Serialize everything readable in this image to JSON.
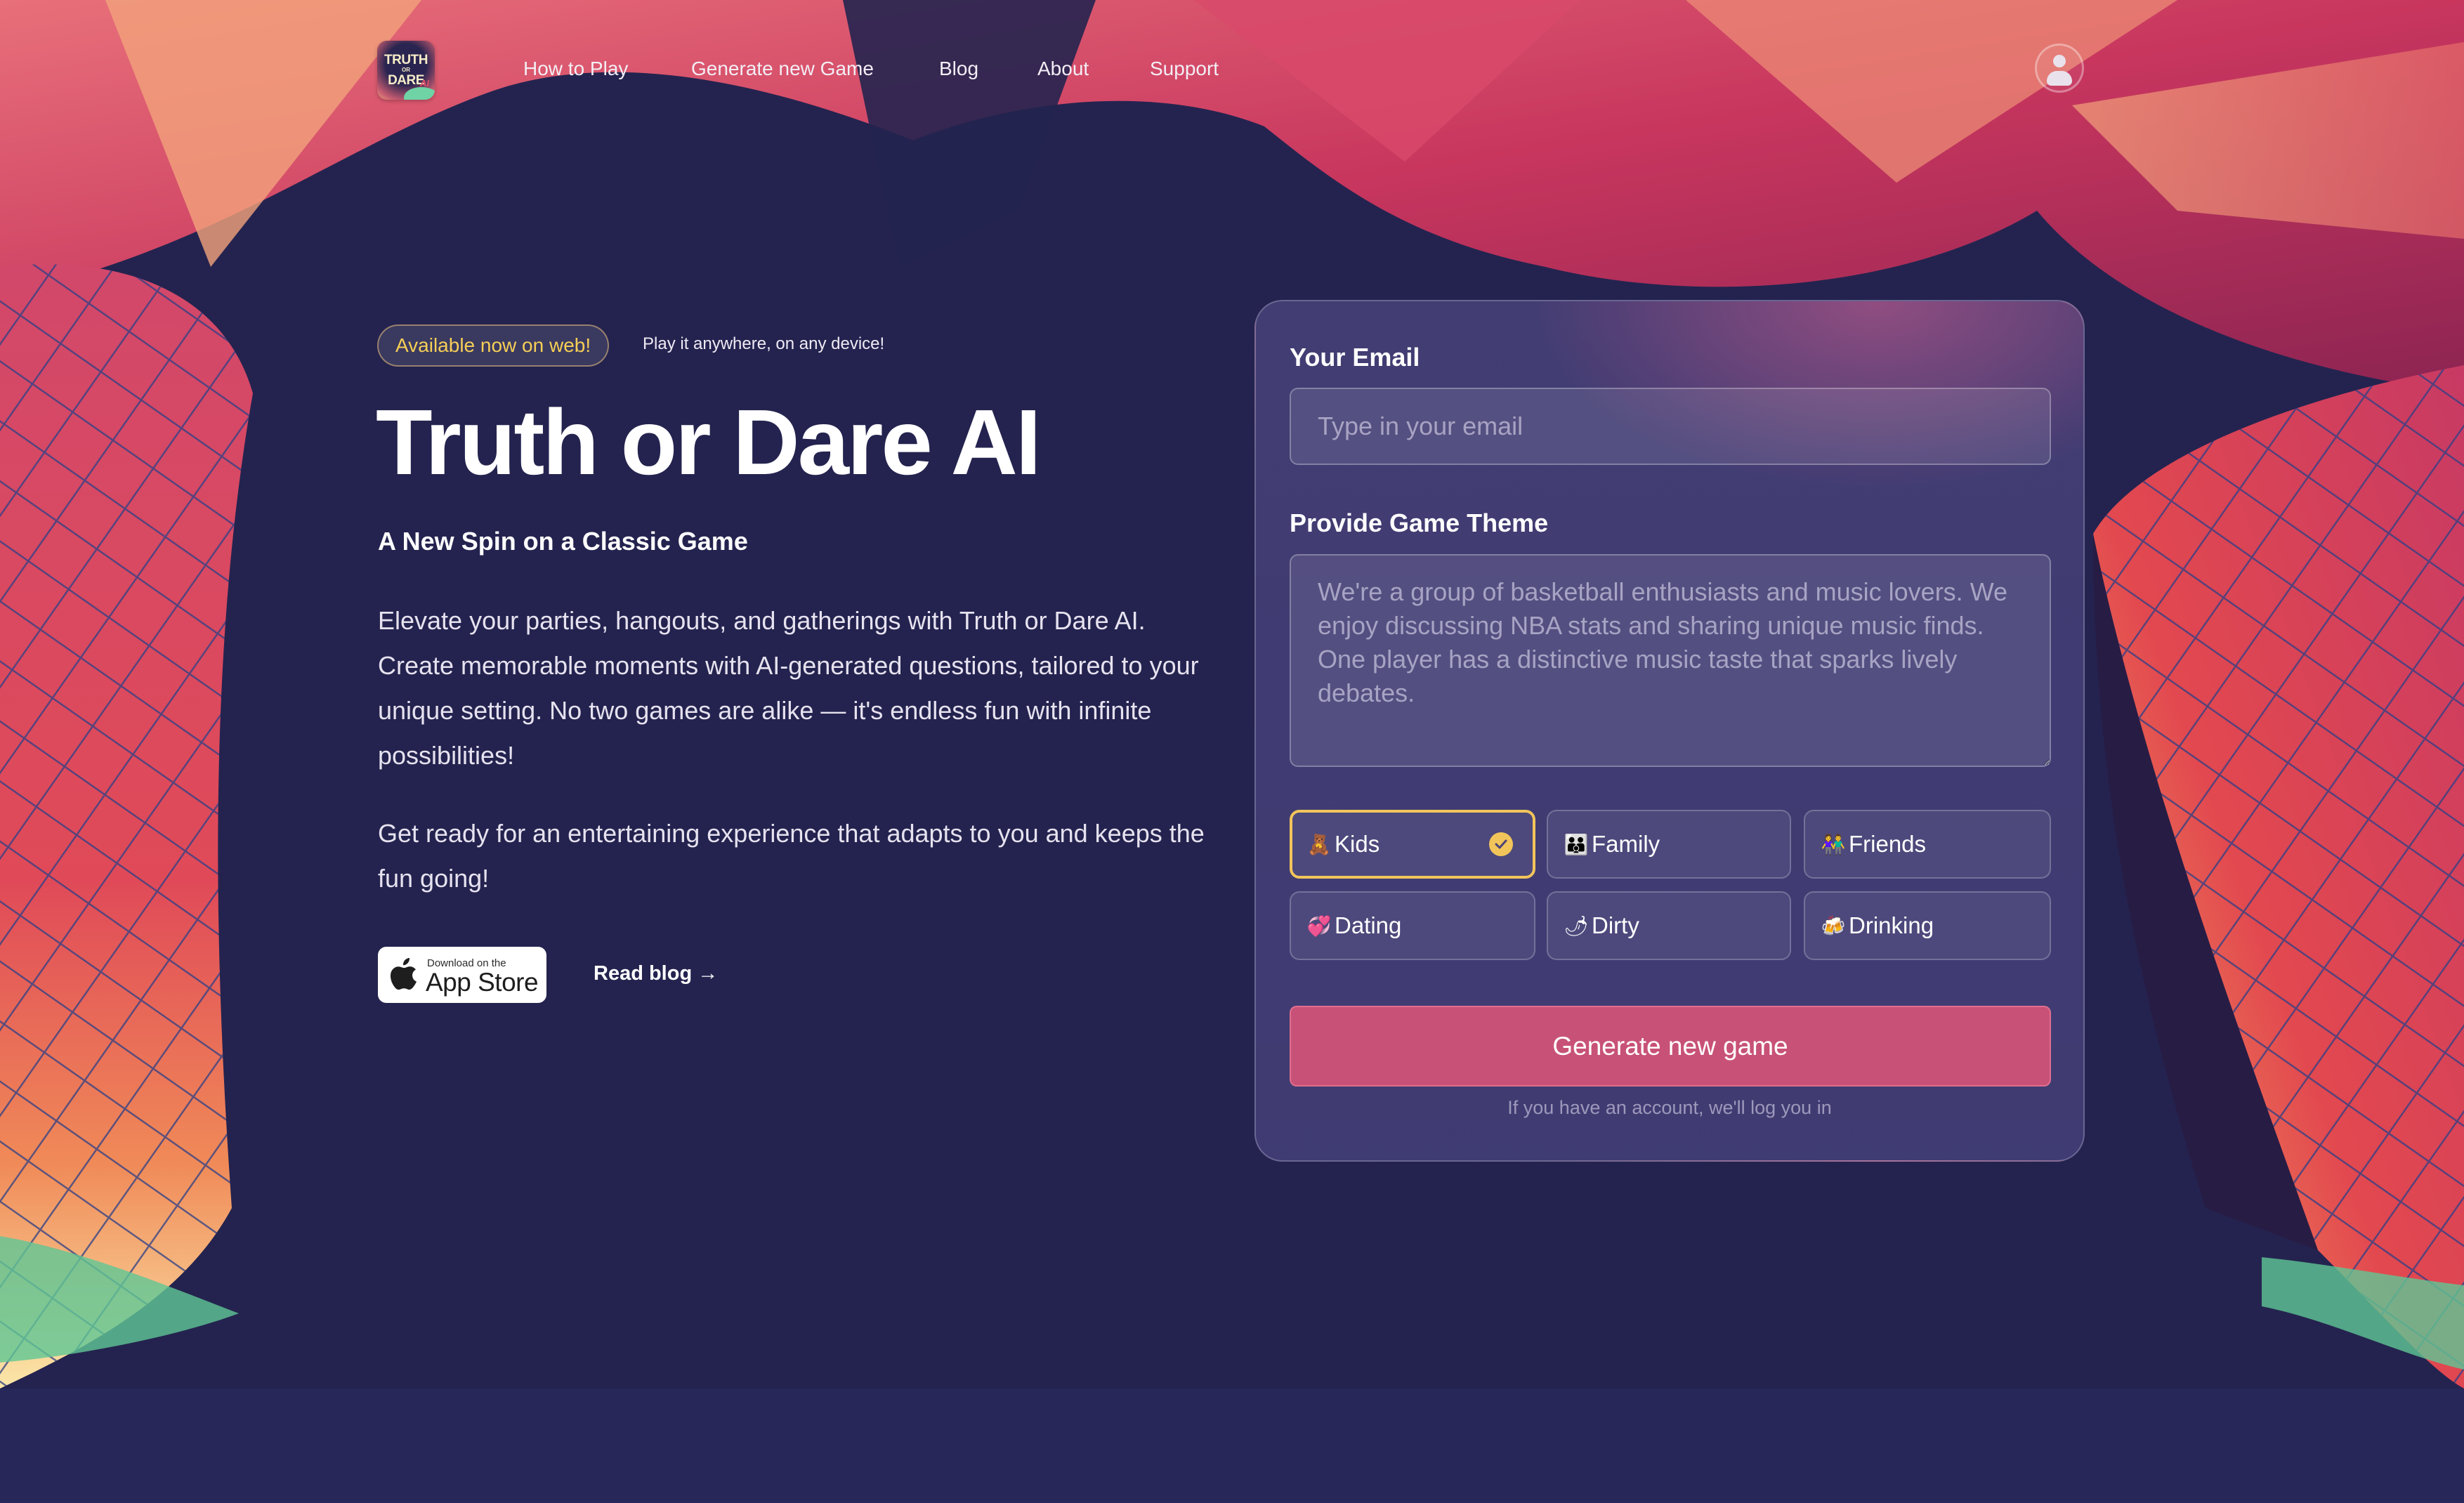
{
  "nav": {
    "logo": {
      "line1": "TRUTH",
      "line2": "OR",
      "line3": "DARE",
      "ai": "AI"
    },
    "links": [
      {
        "label": "How to Play"
      },
      {
        "label": "Generate new Game"
      },
      {
        "label": "Blog"
      },
      {
        "label": "About"
      },
      {
        "label": "Support"
      }
    ],
    "account_icon": "user-circle-icon"
  },
  "hero": {
    "badge": "Available now on web!",
    "badge_note": "Play it anywhere, on any device!",
    "title": "Truth or Dare AI",
    "subtitle": "A New Spin on a Classic Game",
    "paragraph1": "Elevate your parties, hangouts, and gatherings with Truth or Dare AI. Create memorable moments with AI-generated questions, tailored to your unique setting. No two games are alike — it's endless fun with infinite possibilities!",
    "paragraph2": "Get ready for an entertaining experience that adapts to you and keeps the fun going!",
    "appstore": {
      "small": "Download on the",
      "big": "App Store",
      "icon": "apple-icon"
    },
    "read_blog": "Read blog →"
  },
  "form": {
    "email_label": "Your Email",
    "email_placeholder": "Type in your email",
    "email_value": "",
    "theme_label": "Provide Game Theme",
    "theme_placeholder": "We're a group of basketball enthusiasts and music lovers. We enjoy discussing NBA stats and sharing unique music finds. One player has a distinctive music taste that sparks lively debates.",
    "theme_value": "",
    "categories": [
      {
        "label": "Kids",
        "emoji": "🧸",
        "icon": "teddy-bear-icon",
        "selected": true
      },
      {
        "label": "Family",
        "emoji": "👪",
        "icon": "family-icon",
        "selected": false
      },
      {
        "label": "Friends",
        "emoji": "👫",
        "icon": "friends-icon",
        "selected": false
      },
      {
        "label": "Dating",
        "emoji": "💞",
        "icon": "hearts-icon",
        "selected": false
      },
      {
        "label": "Dirty",
        "emoji": "🌶",
        "icon": "chili-pepper-icon",
        "selected": false
      },
      {
        "label": "Drinking",
        "emoji": "🍻",
        "icon": "beer-mugs-icon",
        "selected": false
      }
    ],
    "submit_label": "Generate new game",
    "login_note": "If you have an account, we'll log you in"
  },
  "colors": {
    "background": "#27275a",
    "accent_pink": "#c85277",
    "accent_yellow": "#f2c55a",
    "card_border": "#6a6490"
  }
}
